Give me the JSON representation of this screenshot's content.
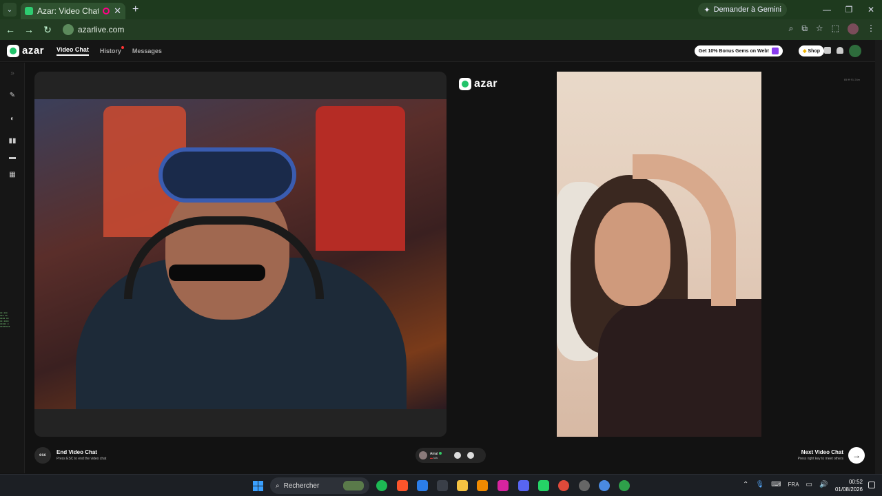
{
  "browser": {
    "tab_title": "Azar: Video Chat with New",
    "tab_close": "✕",
    "new_tab": "+",
    "gemini_label": "Demander à Gemini",
    "url": "azarlive.com",
    "win_min": "—",
    "win_max": "❐",
    "win_close": "✕"
  },
  "app": {
    "logo_text": "azar",
    "nav": {
      "video_chat": "Video Chat",
      "history": "History",
      "messages": "Messages"
    },
    "bonus_label": "Get 10% Bonus Gems on Web!",
    "shop_label": "Shop"
  },
  "video": {
    "right_logo_text": "azar",
    "watermark": "65 fff 91 24m"
  },
  "bottom": {
    "esc_label": "esc",
    "end_title": "End Video Chat",
    "end_sub": "Press ESC to end the video chat",
    "peer_name": "Amal",
    "peer_country": "MA",
    "next_title": "Next Video Chat",
    "next_sub": "Press right key to meet others",
    "next_arrow": "→"
  },
  "taskbar": {
    "search_label": "Rechercher",
    "lang": "FRA",
    "time": "00:52",
    "date": "01/08/2026"
  },
  "colors": {
    "accent_green": "#22c36a",
    "chrome_green": "#1e3a1e",
    "background": "#121212"
  }
}
